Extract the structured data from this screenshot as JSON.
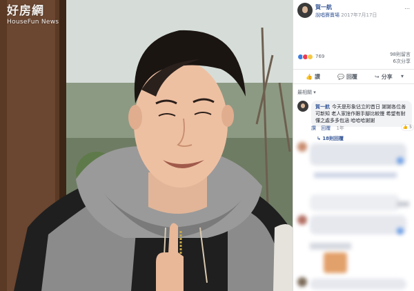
{
  "watermark": {
    "cn": "好房網",
    "en": "HouseFun News"
  },
  "post": {
    "author": "賀一航",
    "page_name": "說唱賽賣場",
    "date": "2017年7月17日",
    "more": "..."
  },
  "reactions": {
    "count": "769",
    "comments": "98則留言",
    "shares": "6次分享"
  },
  "actions": {
    "like": "讚",
    "reply": "回覆",
    "share": "分享",
    "more": "▾"
  },
  "filter": "最相關 ▾",
  "comment": {
    "author": "賀一航",
    "text": "今天是形象佔立的首日 謝謝各位善可新知 老人家捨作跟手腳比較慢 希望有耐懂之處多多包涵 哈哈哈謝謝",
    "like_badge": "5",
    "like_label": "讚",
    "reply_label": "回覆",
    "time": "1年",
    "replies": "18則回覆"
  },
  "colors": {
    "fb_blue": "#385898",
    "like_blue": "#3b7de0",
    "love_red": "#ee3b52",
    "haha_yellow": "#f7c844"
  },
  "icons": [
    "like-icon",
    "reply-icon",
    "share-icon",
    "reaction-like-icon",
    "reaction-love-icon",
    "reaction-haha-icon"
  ]
}
